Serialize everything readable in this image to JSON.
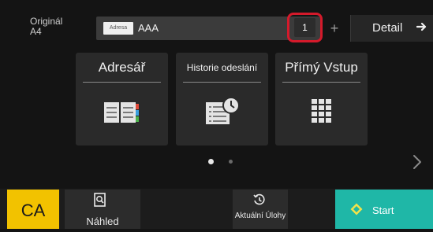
{
  "original": {
    "label": "Originál",
    "size": "A4"
  },
  "address": {
    "tag": "Adresa",
    "value": "AAA"
  },
  "address_count": "1",
  "plus_label": "+",
  "detail_label": "Detail",
  "tiles": [
    {
      "label": "Adresář",
      "icon": "address-book-icon"
    },
    {
      "label": "Historie odeslání",
      "icon": "send-history-icon"
    },
    {
      "label": "Přímý Vstup",
      "icon": "keypad-icon"
    }
  ],
  "pagination": {
    "pages": 2,
    "current": 1
  },
  "bottom": {
    "ca_label": "CA",
    "preview_label": "Náhled",
    "jobs_label": "Aktuální Úlohy",
    "start_label": "Start"
  },
  "colors": {
    "ca": "#f2c200",
    "start": "#1fb7a7",
    "highlight": "#d41a2b",
    "background": "#141414"
  }
}
